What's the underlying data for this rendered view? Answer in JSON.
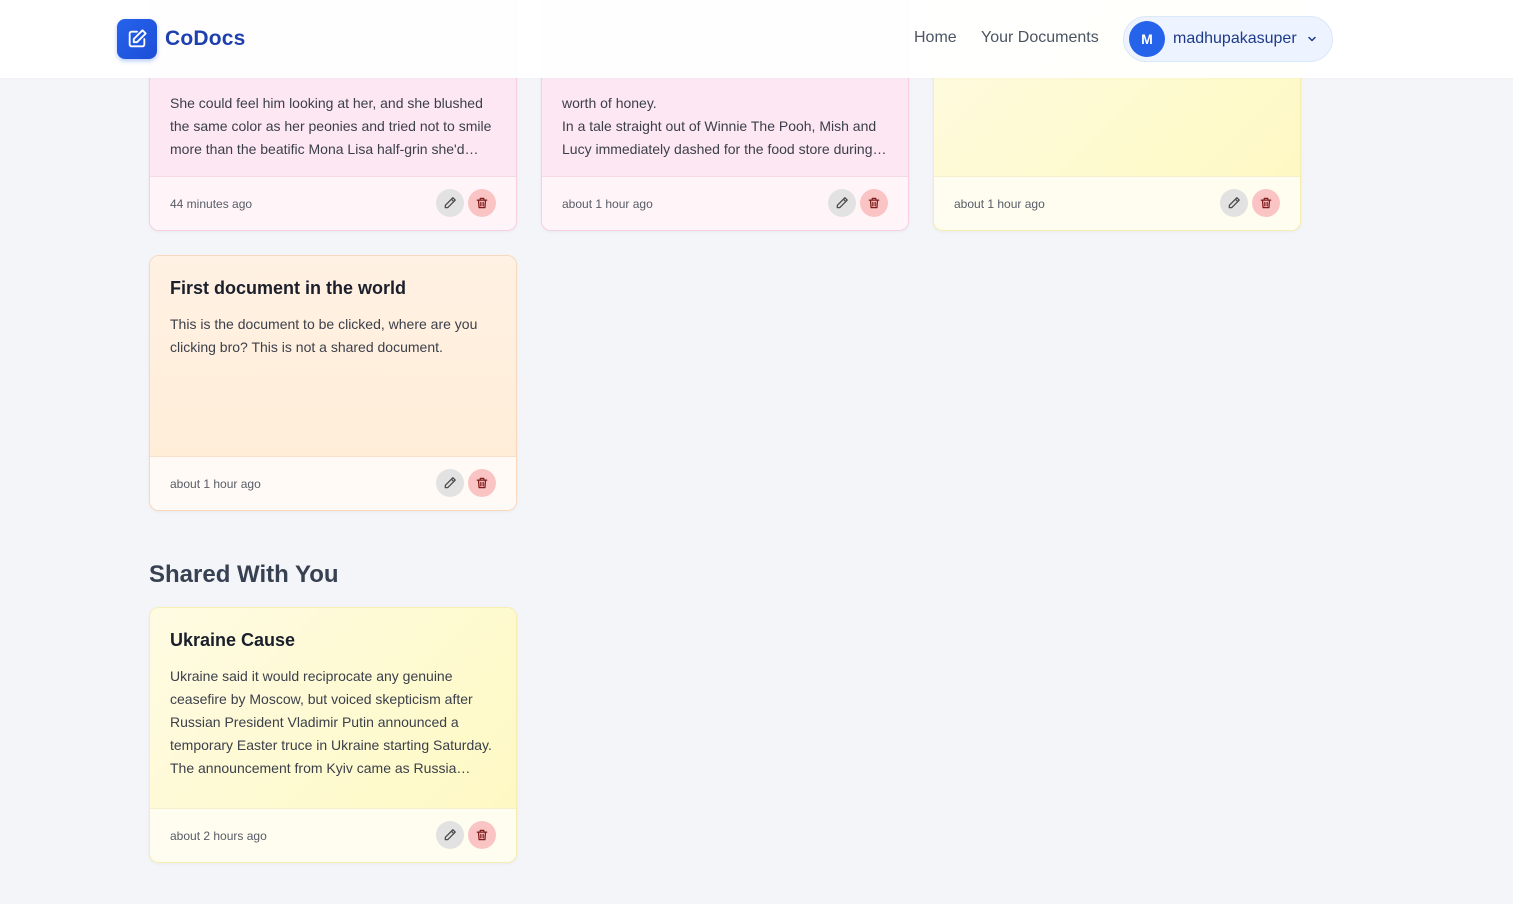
{
  "app": {
    "brand": "CoDocs",
    "accent": "#2563eb"
  },
  "nav": {
    "home": "Home",
    "documents": "Your Documents"
  },
  "user": {
    "initial": "M",
    "name": "madhupakasuper"
  },
  "documents": [
    {
      "title": "",
      "excerpt": "She could feel him looking at her, and she blushed the same color as her peonies and tried not to smile more than the beatific Mona Lisa half-grin she'd have to hold for the photos.",
      "time": "44 minutes ago",
      "color": "pink"
    },
    {
      "title": "",
      "excerpt": "worth of honey.\nIn a tale straight out of Winnie The Pooh, Mish and Lucy immediately dashed for the food store during the visit.",
      "time": "about 1 hour ago",
      "color": "pink"
    },
    {
      "title": "",
      "excerpt": "",
      "time": "about 1 hour ago",
      "color": "yellow"
    },
    {
      "title": "First document in the world",
      "excerpt": "This is the document to be clicked, where are you clicking bro? This is not a shared document.",
      "time": "about 1 hour ago",
      "color": "peach"
    }
  ],
  "shared_section": {
    "title": "Shared With You",
    "documents": [
      {
        "title": "Ukraine Cause",
        "excerpt": "Ukraine said it would reciprocate any genuine ceasefire by Moscow, but voiced skepticism after Russian President Vladimir Putin announced a temporary Easter truce in Ukraine starting Saturday. The announcement from Kyiv came as Russia announced the truce.",
        "time": "about 2 hours ago",
        "color": "yellow"
      }
    ]
  }
}
